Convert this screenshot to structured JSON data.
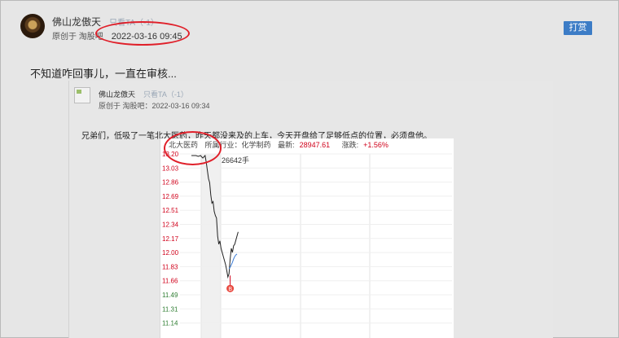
{
  "post": {
    "author": "佛山龙傲天",
    "only_ta": "只看TA（-1）",
    "source_label": "原创于 淘股吧",
    "date": "2022-03-16 09:45",
    "tip_button": "打赏",
    "text": "不知道咋回事儿，一直在审核..."
  },
  "quote": {
    "author": "佛山龙傲天",
    "only_ta": "只看TA（-1）",
    "meta": "原创于 淘股吧：2022-03-16 09:34",
    "text": "兄弟们，低吸了一笔北大医药，昨天都没来及的上车，今天开盘给了足够低点的位置，必须盘他。"
  },
  "chart_header": {
    "stock": "北大医药",
    "industry": "所属行业：化学制药",
    "latest_label": "最新:",
    "latest_value": "28947.61",
    "change_label": "涨跌:",
    "change_value": "+1.56%"
  },
  "chart_data": {
    "type": "line",
    "title": "",
    "y_ticks": [
      "13.20",
      "13.03",
      "12.86",
      "12.69",
      "12.51",
      "12.34",
      "12.17",
      "12.00",
      "11.83",
      "11.66",
      "11.49",
      "11.31",
      "11.14"
    ],
    "ylim": [
      11.14,
      13.2
    ],
    "volume_label": "26642手",
    "marker_label": "B",
    "series": [
      {
        "color": "#222222",
        "x": [
          0,
          4,
          8,
          12,
          16,
          20,
          24,
          26,
          28,
          30,
          32,
          34,
          36,
          38,
          40,
          42,
          44,
          46,
          48,
          50,
          52,
          54,
          56,
          58,
          60,
          62,
          64,
          66,
          68,
          70,
          72,
          74,
          76,
          78,
          80,
          82
        ],
        "y": [
          13.18,
          13.18,
          13.18,
          13.17,
          13.18,
          13.15,
          13.18,
          13.1,
          13.0,
          12.9,
          12.85,
          12.7,
          12.6,
          12.62,
          12.5,
          12.45,
          12.42,
          12.2,
          12.1,
          12.14,
          12.05,
          12.0,
          11.95,
          11.9,
          11.85,
          11.78,
          11.7,
          11.74,
          11.92,
          12.05,
          12.0,
          12.08,
          12.1,
          12.15,
          12.2,
          12.25
        ]
      },
      {
        "color": "#3a7bd5",
        "x": [
          66,
          68,
          70,
          72,
          74,
          76,
          78,
          80
        ],
        "y": [
          11.8,
          11.82,
          11.85,
          11.88,
          11.92,
          11.95,
          11.97,
          11.98
        ]
      }
    ],
    "marker": {
      "x": 68,
      "y": 11.6
    },
    "grid": true
  }
}
